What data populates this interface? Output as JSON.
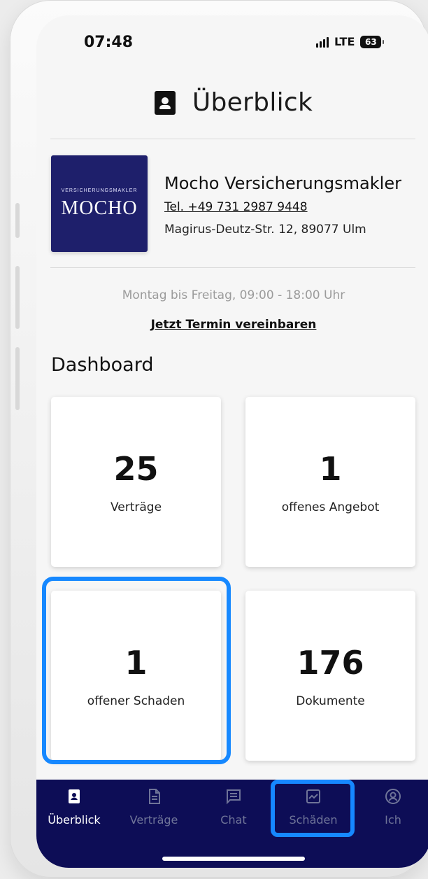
{
  "status": {
    "time": "07:48",
    "network": "LTE",
    "battery": "63"
  },
  "header": {
    "title": "Überblick"
  },
  "broker": {
    "name": "Mocho Versicherungsmakler",
    "phone": "Tel. +49 731 2987 9448",
    "address": "Magirus-Deutz-Str. 12, 89077 Ulm",
    "logo_top": "VERSICHERUNGSMAKLER",
    "logo_main": "MOCHO",
    "logo_color": "#1e1f6b"
  },
  "contact": {
    "hours": "Montag bis Freitag, 09:00 - 18:00 Uhr",
    "appointment_link": "Jetzt Termin vereinbaren"
  },
  "dashboard": {
    "title": "Dashboard",
    "cards": [
      {
        "value": "25",
        "label": "Verträge"
      },
      {
        "value": "1",
        "label": "offenes Angebot"
      },
      {
        "value": "1",
        "label": "offener Schaden"
      },
      {
        "value": "176",
        "label": "Dokumente"
      }
    ]
  },
  "bottom_nav": {
    "items": [
      {
        "label": "Überblick",
        "icon": "overview-icon",
        "active": true
      },
      {
        "label": "Verträge",
        "icon": "document-icon"
      },
      {
        "label": "Chat",
        "icon": "chat-icon"
      },
      {
        "label": "Schäden",
        "icon": "claims-icon"
      },
      {
        "label": "Ich",
        "icon": "profile-icon"
      }
    ]
  },
  "colors": {
    "nav_background": "#0d0d56",
    "highlight": "#1688ff",
    "background": "#f6f6f6"
  }
}
